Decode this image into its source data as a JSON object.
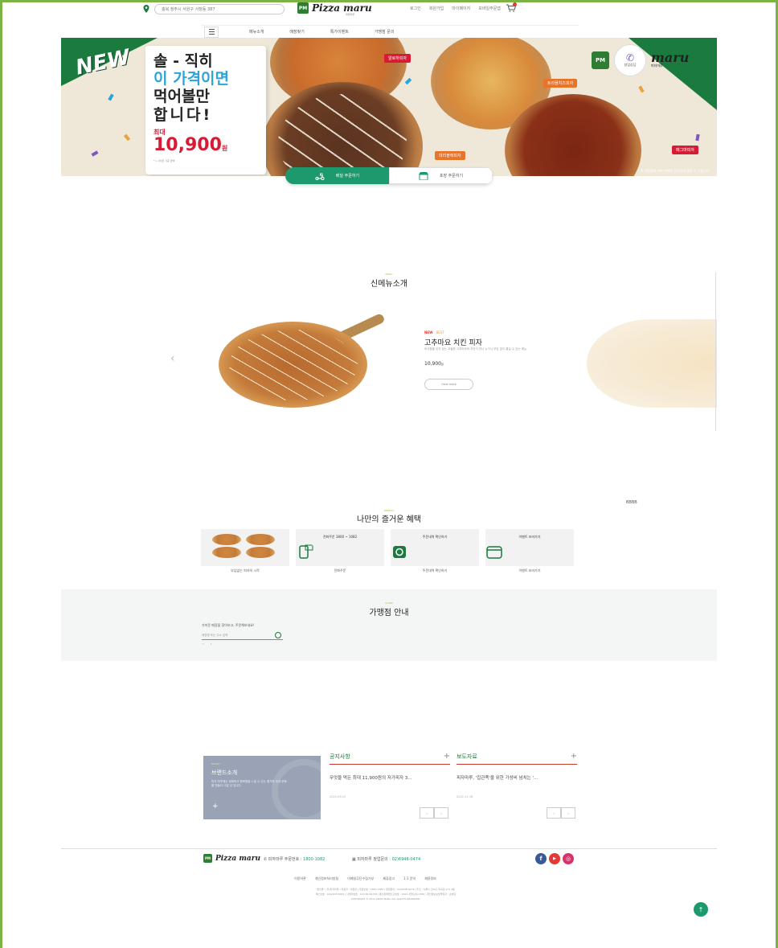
{
  "header": {
    "location": "충북 청주시 서원구 사창동 387",
    "logo_text": "Pizza maru",
    "logo_mark": "PM",
    "logo_sub": "피자마루",
    "util_links": [
      "로그인",
      "회원가입",
      "마이페이지",
      "모바일주문앱"
    ]
  },
  "nav": {
    "items": [
      "메뉴소개",
      "매장찾기",
      "특가이벤트",
      "가맹점 문의"
    ]
  },
  "banner": {
    "new_tag": "NEW",
    "line1": "솔 - 직히",
    "line2": "이 가격이면",
    "line3": "먹어볼만",
    "line4": "합니다!",
    "max_label": "최대",
    "price": "10,900",
    "price_unit": "원",
    "price_note": "* L 사이즈 기준 금액",
    "pizza_labels": [
      "알로하피자",
      "트리플치즈피자",
      "데리블랙피자",
      "매그마피자"
    ],
    "brand_text": "maru",
    "brand_sub": "피자마루",
    "brand_mark": "PM",
    "consult_label": "창업상담",
    "note": "※ 가맹점에 따라 이벤트 참여하지 않을 수 있습니다."
  },
  "order_tabs": {
    "delivery": "배달 주문하기",
    "pickup": "포장 주문하기"
  },
  "new_menu": {
    "eyebrow": "MENU",
    "title": "신메뉴소개",
    "badge_new": "NEW",
    "badge_hot": "BEST",
    "name": "고추마요 치킨 피자",
    "desc": "바삭함을 잊지 않는 꼬들한 고추마요와 치킨이 만나 누구나 부담 없이 즐길 수 있는 메뉴",
    "price": "10,900",
    "price_unit": "원",
    "button": "View more"
  },
  "benefits": {
    "eyebrow": "BENEFIT",
    "title": "나만의 즐거운 혜택",
    "cards": [
      {
        "header": "",
        "caption": "부담없는 피자의 시작"
      },
      {
        "header": "전화주문 1800 ~ 1082",
        "caption": "전화주문"
      },
      {
        "header": "주문내역 확인하기",
        "caption": "주문내역 확인하기"
      },
      {
        "header": "이벤트 보러가기",
        "caption": "이벤트 보러가기"
      }
    ]
  },
  "store": {
    "eyebrow": "STORE",
    "title": "가맹점 안내",
    "desc": "가까운 매장을 찾아보고, 주문해보세요!",
    "placeholder": "매장명 또는 주소 입력",
    "pager": [
      "‹",
      "›"
    ]
  },
  "brand": {
    "eyebrow": "BRAND",
    "title": "브랜드소개",
    "desc": "피자 마루에는 정확하고 행복함을 느낄 수 있는 즐거운 피자 문화를 만들어 나갈 것 입니다.",
    "plus": "+"
  },
  "notices": {
    "title": "공지사항",
    "item": "무엇을 먹든 최대 11,900원의 저가피자 3...",
    "date": "2022-09-22",
    "plus": "+"
  },
  "press": {
    "title": "보도자료",
    "item": "피자마루, '집관족'을 위한 가성비 넘치는 '...",
    "date": "2022-11-16",
    "plus": "+"
  },
  "pager": [
    "‹",
    "›"
  ],
  "footer": {
    "logo_text": "Pizza maru",
    "logo_mark": "PM",
    "phone_label": "피자마루 주문번호 :",
    "phone": "1800-1082",
    "fran_label": "피자마루 창업문의 :",
    "fran": "02)6948-0474",
    "links": [
      "이용약관",
      "개인정보처리방침",
      "이메일무단수집거부",
      "제휴광고",
      "1:1 문의",
      "채용정보"
    ],
    "info_line1": "법인명 : (주)피자마루  |  대표자 : 이원장  |  주문번호 : 1800-1082  |  창업문의 : 02)6948-0474  |  주소 : 서울시 강서구 화곡로 271 4층",
    "info_line2": "팩스번호 : 02)2607-5065  |  사업자번호 : 113-86-50338  |  통신판매업신고번호 : 2021-서울강서-1582  |  개인정보보호책임자 : 손성민",
    "copyright": "COPYRIGHT © 2013 PIZZA MARU ALL RIGHTS RESERVED.",
    "sns": [
      "f",
      "▶",
      "◎"
    ],
    "top_label": "↑"
  },
  "misc": {
    "scroll_badge": "BBBB"
  }
}
